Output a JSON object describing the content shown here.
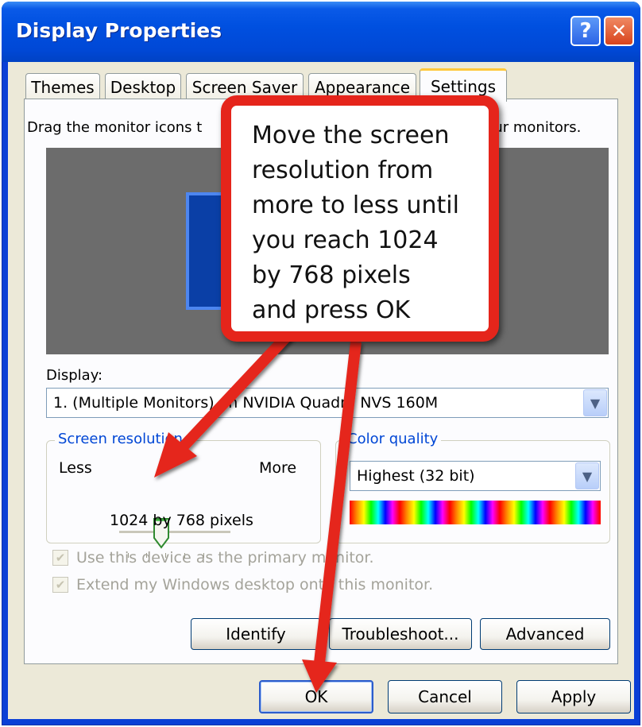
{
  "window": {
    "title": "Display Properties"
  },
  "tabs": [
    "Themes",
    "Desktop",
    "Screen Saver",
    "Appearance",
    "Settings"
  ],
  "active_tab": "Settings",
  "settings": {
    "instruction_left": "Drag the monitor icons t",
    "instruction_right": "our monitors.",
    "display_label": "Display:",
    "display_value": "1. (Multiple Monitors) on NVIDIA Quadro NVS 160M",
    "screen_resolution": {
      "label": "Screen resolution",
      "less": "Less",
      "more": "More",
      "value": "1024 by 768 pixels"
    },
    "color_quality": {
      "label": "Color quality",
      "value": "Highest (32 bit)"
    },
    "checkboxes": [
      {
        "label": "Use this device as the primary monitor.",
        "checked": true
      },
      {
        "label": "Extend my Windows desktop onto this monitor.",
        "checked": true
      }
    ],
    "buttons": {
      "identify": "Identify",
      "troubleshoot": "Troubleshoot...",
      "advanced": "Advanced"
    }
  },
  "dialog_buttons": {
    "ok": "OK",
    "cancel": "Cancel",
    "apply": "Apply"
  },
  "callout": {
    "lines": [
      "Move the screen",
      "resolution from",
      "more to less until",
      "you reach 1024",
      "by 768 pixels",
      "and press OK"
    ],
    "border_color": "#e5251b"
  },
  "colors": {
    "title_bar": "#0050e0",
    "group_label": "#0046d5",
    "face": "#ece9d8"
  }
}
